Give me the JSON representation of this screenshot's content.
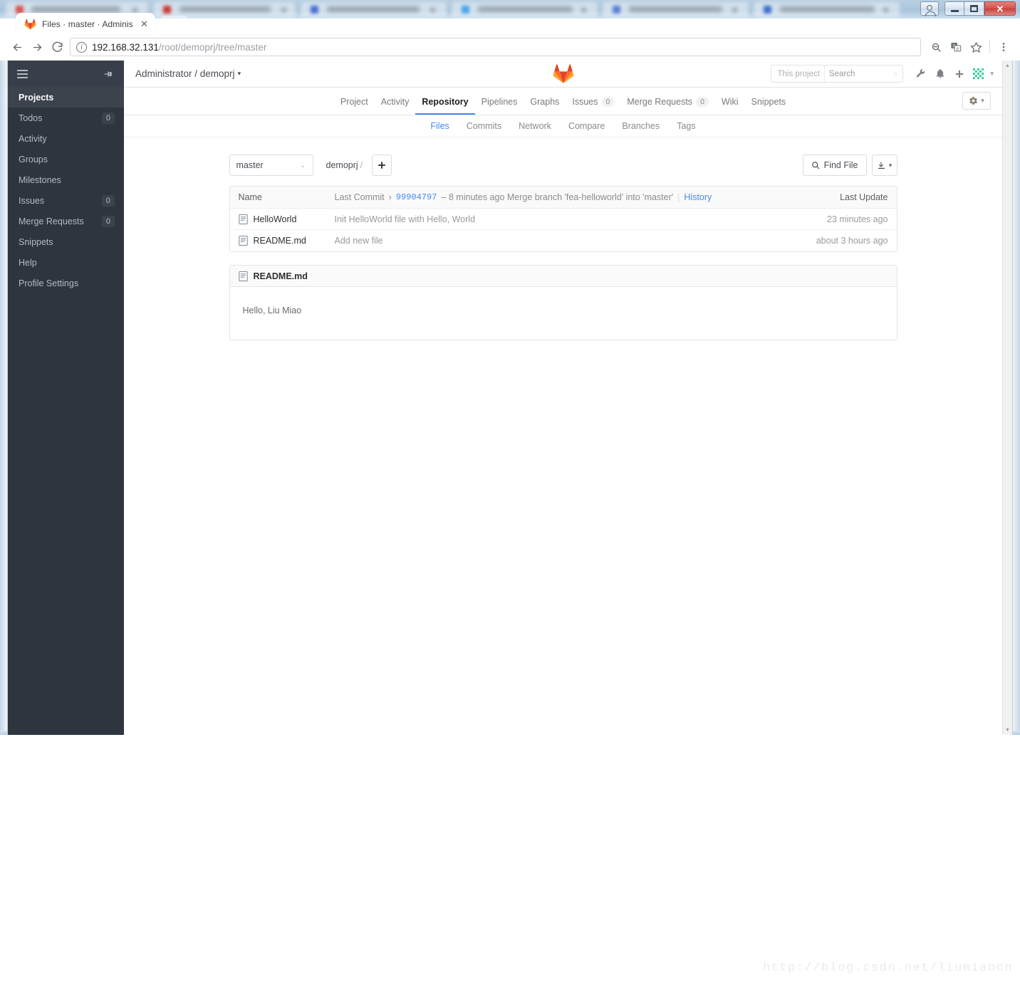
{
  "browser": {
    "tab": {
      "title": "Files · master · Adminis",
      "favicon": "gitlab-fox-icon",
      "close": "✕"
    },
    "nav": {
      "back": "←",
      "forward": "→",
      "reload": "⟳"
    },
    "address": {
      "protocol_icon": "info-circle-icon",
      "host": "192.168.32.131",
      "path": "/root/demoprj/tree/master"
    },
    "toolbar_icons": {
      "zoom_out": "zoom-out-icon",
      "translate": "translate-icon",
      "bookmark": "star-icon",
      "menu": "three-dot-menu-icon"
    },
    "window_controls": {
      "user": "user-account-icon",
      "minimize": "–",
      "maximize": "❐",
      "close": "✕"
    }
  },
  "sidebar": {
    "hamburger": "hamburger-icon",
    "pin": "pin-icon",
    "items": [
      {
        "label": "Projects",
        "badge": "",
        "active": true
      },
      {
        "label": "Todos",
        "badge": "0",
        "active": false
      },
      {
        "label": "Activity",
        "badge": "",
        "active": false
      },
      {
        "label": "Groups",
        "badge": "",
        "active": false
      },
      {
        "label": "Milestones",
        "badge": "",
        "active": false
      },
      {
        "label": "Issues",
        "badge": "0",
        "active": false
      },
      {
        "label": "Merge Requests",
        "badge": "0",
        "active": false
      },
      {
        "label": "Snippets",
        "badge": "",
        "active": false
      },
      {
        "label": "Help",
        "badge": "",
        "active": false
      },
      {
        "label": "Profile Settings",
        "badge": "",
        "active": false
      }
    ]
  },
  "header": {
    "breadcrumb": "Administrator / demoprj",
    "breadcrumb_caret": "▾",
    "logo": "gitlab-logo",
    "search": {
      "scope": "This project",
      "placeholder": "Search",
      "icon": "search-icon"
    },
    "icons": {
      "wrench": "wrench-icon",
      "bell": "bell-icon",
      "plus": "plus-icon",
      "avatar": "user-avatar",
      "avatar_caret": "▾"
    }
  },
  "project_nav": {
    "items": [
      {
        "label": "Project",
        "count": "",
        "active": false
      },
      {
        "label": "Activity",
        "count": "",
        "active": false
      },
      {
        "label": "Repository",
        "count": "",
        "active": true
      },
      {
        "label": "Pipelines",
        "count": "",
        "active": false
      },
      {
        "label": "Graphs",
        "count": "",
        "active": false
      },
      {
        "label": "Issues",
        "count": "0",
        "active": false
      },
      {
        "label": "Merge Requests",
        "count": "0",
        "active": false
      },
      {
        "label": "Wiki",
        "count": "",
        "active": false
      },
      {
        "label": "Snippets",
        "count": "",
        "active": false
      }
    ],
    "settings": {
      "icon": "gear-icon",
      "caret": "▾"
    }
  },
  "sub_nav": {
    "items": [
      {
        "label": "Files",
        "active": true
      },
      {
        "label": "Commits",
        "active": false
      },
      {
        "label": "Network",
        "active": false
      },
      {
        "label": "Compare",
        "active": false
      },
      {
        "label": "Branches",
        "active": false
      },
      {
        "label": "Tags",
        "active": false
      }
    ]
  },
  "repo_toolbar": {
    "branch": "master",
    "branch_caret": "⌄",
    "path": "demoprj",
    "path_separator": "/",
    "add_button": "＋",
    "find_file": {
      "label": "Find File",
      "icon": "search-icon"
    },
    "download": {
      "icon": "download-icon",
      "caret": "▾"
    }
  },
  "file_table": {
    "headers": {
      "name": "Name",
      "last_commit": "Last Commit",
      "last_update": "Last Update"
    },
    "header_commit": {
      "chevron": "›",
      "sha": "99904797",
      "separator": "–",
      "time": "8 minutes ago",
      "message": "Merge branch 'fea-helloworld' into 'master'",
      "history": "History"
    },
    "rows": [
      {
        "icon": "file-icon",
        "name": "HelloWorld",
        "commit_message": "Init HelloWorld file with Hello, World",
        "updated": "23 minutes ago"
      },
      {
        "icon": "file-icon",
        "name": "README.md",
        "commit_message": "Add new file",
        "updated": "about 3 hours ago"
      }
    ]
  },
  "readme": {
    "icon": "file-icon",
    "title": "README.md",
    "content": "Hello, Liu Miao"
  },
  "scrollbar": {
    "up": "▲",
    "down": "▼"
  },
  "watermark": "http://blog.csdn.net/liumiaocn",
  "colors": {
    "sidebar_bg": "#2e353e",
    "sidebar_active": "#3c434d",
    "accent_blue": "#4688f1",
    "gitlab_orange": "#e24329"
  }
}
